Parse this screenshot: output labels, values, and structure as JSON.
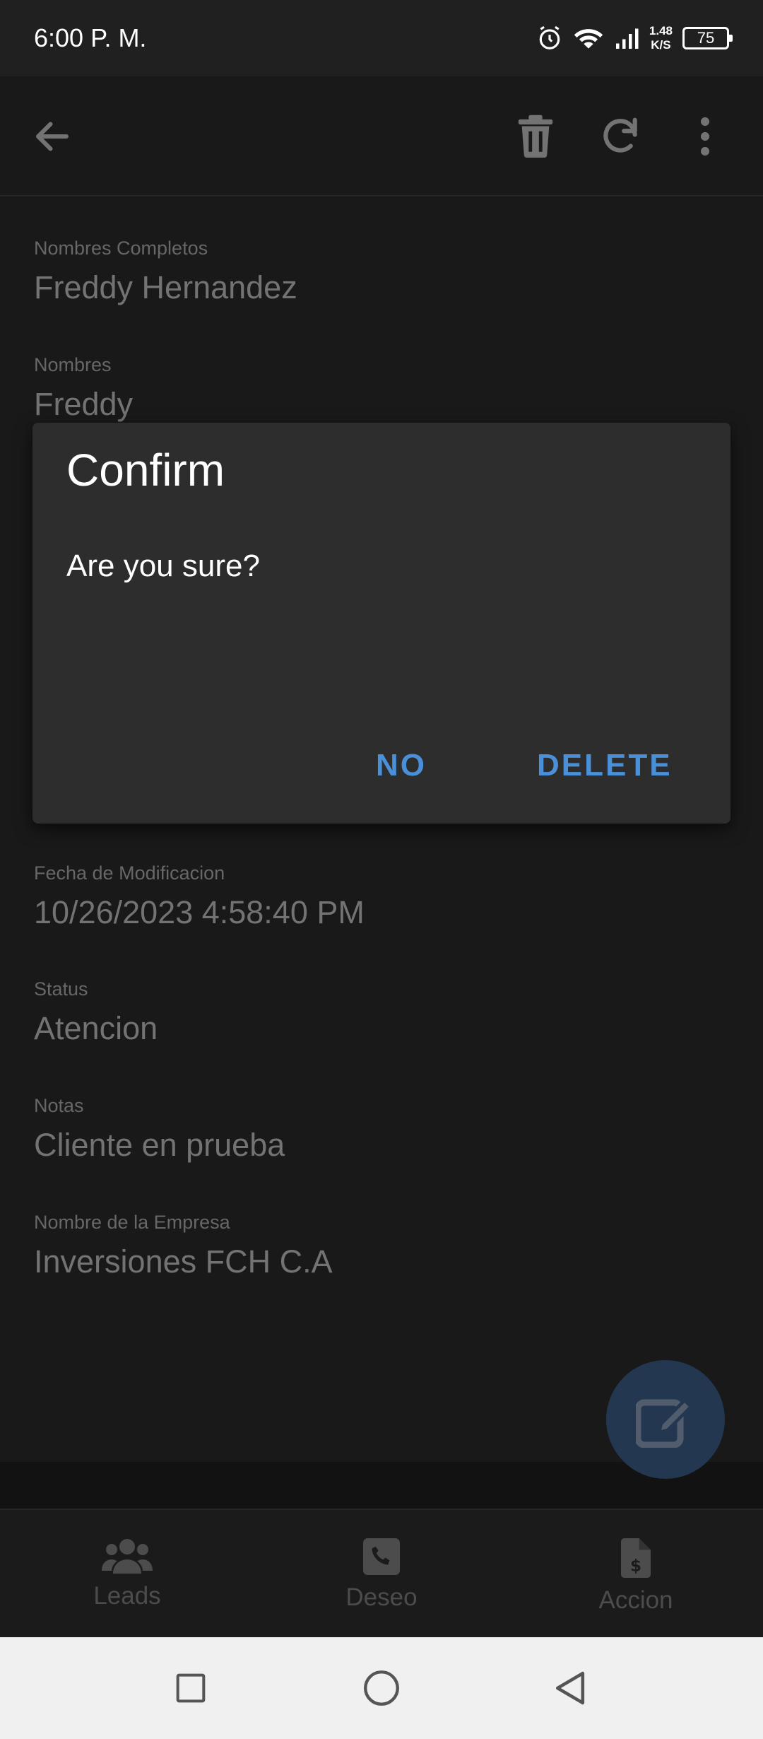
{
  "status_bar": {
    "time": "6:00 P. M.",
    "net_speed_top": "1.48",
    "net_speed_bottom": "K/S",
    "battery": "75"
  },
  "app_bar": {
    "back_icon": "arrow-left-icon",
    "delete_icon": "trash-icon",
    "refresh_icon": "refresh-icon",
    "more_icon": "more-vertical-icon"
  },
  "fields": [
    {
      "label": "Nombres Completos",
      "value": "Freddy Hernandez"
    },
    {
      "label": "Nombres",
      "value": "Freddy"
    },
    {
      "label": "Fecha de Modificacion",
      "value": "10/26/2023 4:58:40 PM"
    },
    {
      "label": "Status",
      "value": "Atencion"
    },
    {
      "label": "Notas",
      "value": "Cliente en prueba"
    },
    {
      "label": "Nombre de la Empresa",
      "value": "Inversiones FCH C.A"
    }
  ],
  "dialog": {
    "title": "Confirm",
    "message": "Are you sure?",
    "no_label": "NO",
    "delete_label": "DELETE"
  },
  "fab": {
    "icon": "edit-icon"
  },
  "bottom_nav": [
    {
      "label": "Leads",
      "icon": "users-icon"
    },
    {
      "label": "Deseo",
      "icon": "phone-icon"
    },
    {
      "label": "Accion",
      "icon": "invoice-dollar-icon"
    }
  ],
  "system_nav": {
    "recents_icon": "square-icon",
    "home_icon": "circle-icon",
    "back_icon": "triangle-back-icon"
  },
  "colors": {
    "accent": "#4a90d9",
    "fab": "#2f4a6c",
    "background": "#222222",
    "dialog": "#2d2d2d"
  }
}
